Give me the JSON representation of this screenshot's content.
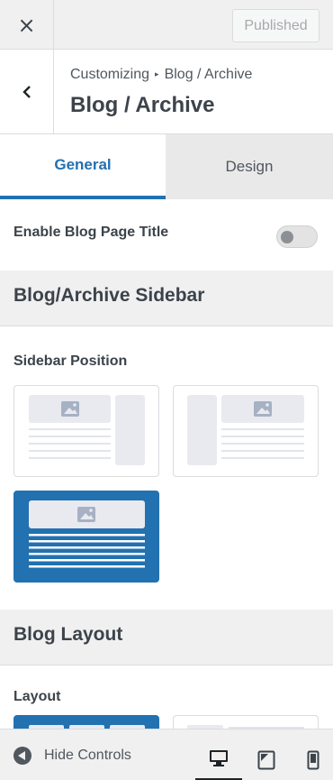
{
  "topbar": {
    "close_label": "×",
    "publish_label": "Published"
  },
  "header": {
    "crumb_parent": "Customizing",
    "crumb_separator": "▸",
    "crumb_current": "Blog / Archive",
    "title": "Blog / Archive"
  },
  "tabs": [
    {
      "label": "General",
      "active": true
    },
    {
      "label": "Design",
      "active": false
    }
  ],
  "enable_title": {
    "label": "Enable Blog Page Title",
    "enabled": false
  },
  "sidebar_section": {
    "title": "Blog/Archive Sidebar",
    "position_label": "Sidebar Position",
    "options": [
      {
        "name": "right-sidebar",
        "selected": false
      },
      {
        "name": "left-sidebar",
        "selected": false
      },
      {
        "name": "no-sidebar",
        "selected": true
      }
    ]
  },
  "blog_layout": {
    "title": "Blog Layout",
    "layout_label": "Layout"
  },
  "bottom": {
    "hide_controls_label": "Hide Controls",
    "devices": [
      {
        "icon": "desktop-icon",
        "active": true
      },
      {
        "icon": "tablet-icon",
        "active": false
      },
      {
        "icon": "mobile-icon",
        "active": false
      }
    ]
  },
  "colors": {
    "accent": "#2271b1",
    "panel_bg": "#f0f0f1",
    "text": "#3c434a",
    "placeholder": "#e8eaf0",
    "placeholder_icon": "#a7b1c4"
  }
}
